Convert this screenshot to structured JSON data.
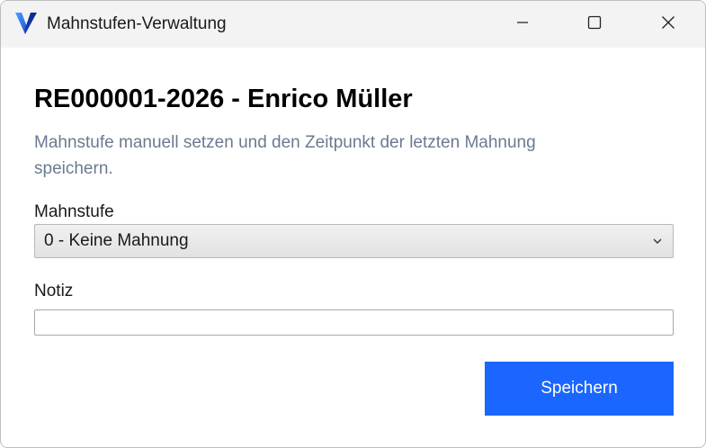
{
  "window": {
    "title": "Mahnstufen-Verwaltung",
    "icon": "app-logo-v-icon",
    "controls": [
      "minimize-icon",
      "maximize-icon",
      "close-icon"
    ]
  },
  "main": {
    "heading": "RE000001-2026 - Enrico Müller",
    "subtitle": "Mahnstufe manuell setzen und den Zeitpunkt der letzten Mahnung speichern.",
    "mahnstufe": {
      "label": "Mahnstufe",
      "selected": "0 - Keine Mahnung"
    },
    "notiz": {
      "label": "Notiz",
      "value": "",
      "placeholder": ""
    },
    "save_label": "Speichern"
  },
  "colors": {
    "accent": "#1a66ff",
    "subtitle": "#6b7a90",
    "titlebar": "#f3f3f3"
  }
}
